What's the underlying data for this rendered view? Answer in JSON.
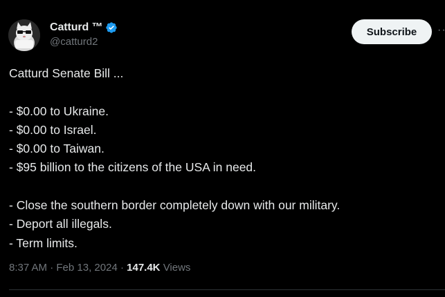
{
  "author": {
    "display_name": "Catturd ™",
    "handle": "@catturd2",
    "verified": true
  },
  "actions": {
    "subscribe_label": "Subscribe",
    "more_label": "···"
  },
  "post": {
    "lines": [
      "Catturd Senate Bill ...",
      "",
      "- $0.00 to Ukraine.",
      "- $0.00 to Israel.",
      "- $0.00 to Taiwan.",
      "- $95 billion to the citizens of the USA in need.",
      "",
      "- Close the southern border completely down with our military.",
      "- Deport all illegals.",
      "- Term limits."
    ]
  },
  "meta": {
    "time": "8:37 AM",
    "separator": " · ",
    "date": "Feb 13, 2024",
    "views_count": "147.4K",
    "views_label": "Views"
  },
  "colors": {
    "background": "#000000",
    "text": "#e7e9ea",
    "muted": "#71767b",
    "verified_badge": "#1d9bf0",
    "button_bg": "#eff3f4",
    "divider": "#2f3336"
  }
}
